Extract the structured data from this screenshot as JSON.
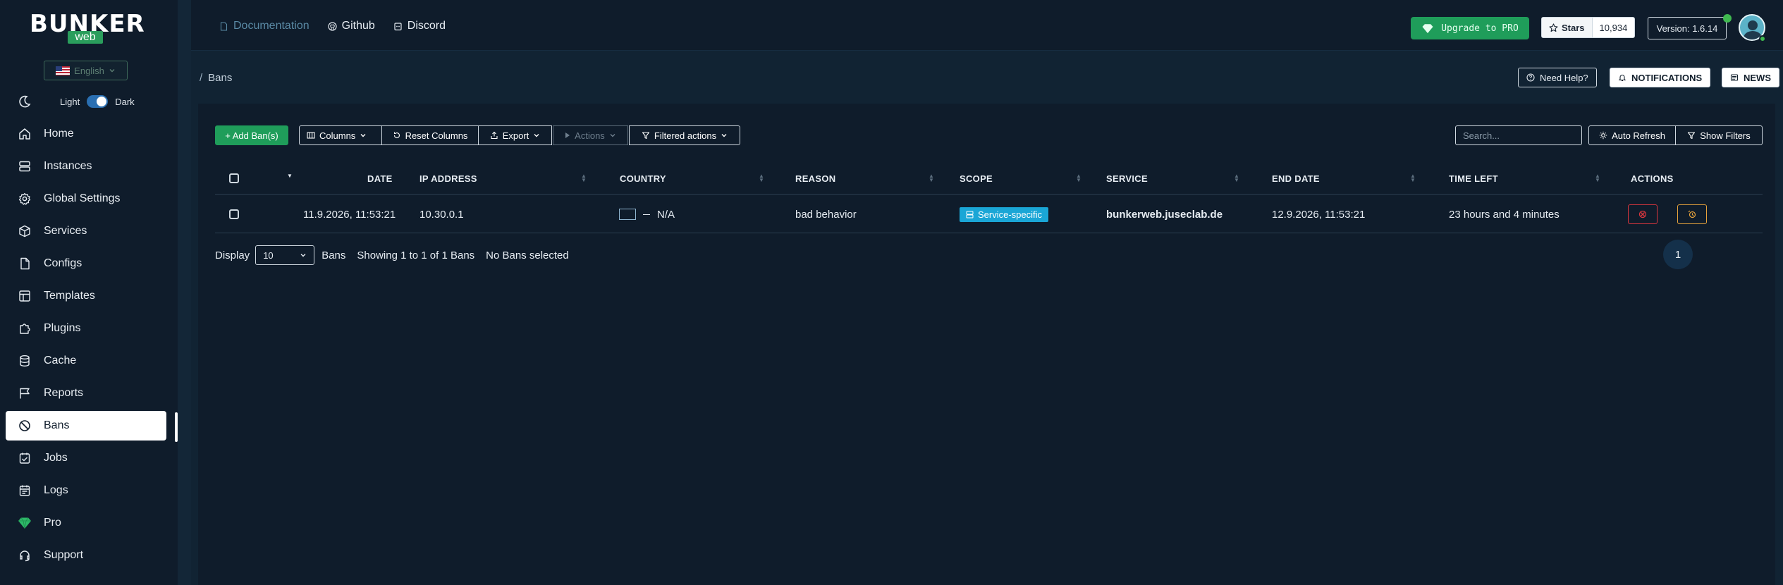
{
  "brand": {
    "name": "BUNKER",
    "sub": "web"
  },
  "sidebar": {
    "language": "English",
    "theme": {
      "light": "Light",
      "dark": "Dark"
    },
    "items": [
      {
        "label": "Home",
        "icon": "home-icon"
      },
      {
        "label": "Instances",
        "icon": "server-icon"
      },
      {
        "label": "Global Settings",
        "icon": "gear-icon"
      },
      {
        "label": "Services",
        "icon": "cube-icon"
      },
      {
        "label": "Configs",
        "icon": "file-icon"
      },
      {
        "label": "Templates",
        "icon": "layout-icon"
      },
      {
        "label": "Plugins",
        "icon": "puzzle-icon"
      },
      {
        "label": "Cache",
        "icon": "database-icon"
      },
      {
        "label": "Reports",
        "icon": "flag-icon"
      },
      {
        "label": "Bans",
        "icon": "ban-icon",
        "active": true
      },
      {
        "label": "Jobs",
        "icon": "calendar-check-icon"
      },
      {
        "label": "Logs",
        "icon": "calendar-icon"
      },
      {
        "label": "Pro",
        "icon": "diamond-icon"
      },
      {
        "label": "Support",
        "icon": "headset-icon"
      }
    ]
  },
  "topbar": {
    "links": [
      "Documentation",
      "Github",
      "Discord"
    ],
    "upgrade": "Upgrade to PRO",
    "stars_label": "Stars",
    "stars_count": "10,934",
    "version": "Version: 1.6.14"
  },
  "header": {
    "breadcrumb_sep": "/",
    "breadcrumb": "Bans",
    "need_help": "Need Help?",
    "notifications": "NOTIFICATIONS",
    "news": "NEWS"
  },
  "toolbar": {
    "add": "+ Add Ban(s)",
    "columns": "Columns",
    "reset_columns": "Reset Columns",
    "export": "Export",
    "actions": "Actions",
    "filtered_actions": "Filtered actions",
    "search_placeholder": "Search...",
    "auto_refresh": "Auto Refresh",
    "show_filters": "Show Filters"
  },
  "table": {
    "columns": [
      "DATE",
      "IP ADDRESS",
      "COUNTRY",
      "REASON",
      "SCOPE",
      "SERVICE",
      "END DATE",
      "TIME LEFT",
      "ACTIONS"
    ],
    "rows": [
      {
        "date": "11.9.2026, 11:53:21",
        "ip": "10.30.0.1",
        "country": "N/A",
        "reason": "bad behavior",
        "scope": "Service-specific",
        "service": "bunkerweb.juseclab.de",
        "end_date": "12.9.2026, 11:53:21",
        "time_left": "23 hours and 4 minutes"
      }
    ]
  },
  "footer": {
    "display": "Display",
    "page_size": "10",
    "bans": "Bans",
    "showing": "Showing 1 to 1 of 1 Bans",
    "selected": "No Bans selected",
    "page": "1"
  },
  "colors": {
    "accent_green": "#1f9d5a",
    "scope_badge": "#1aa6d6",
    "background": "#0f1c2b"
  }
}
